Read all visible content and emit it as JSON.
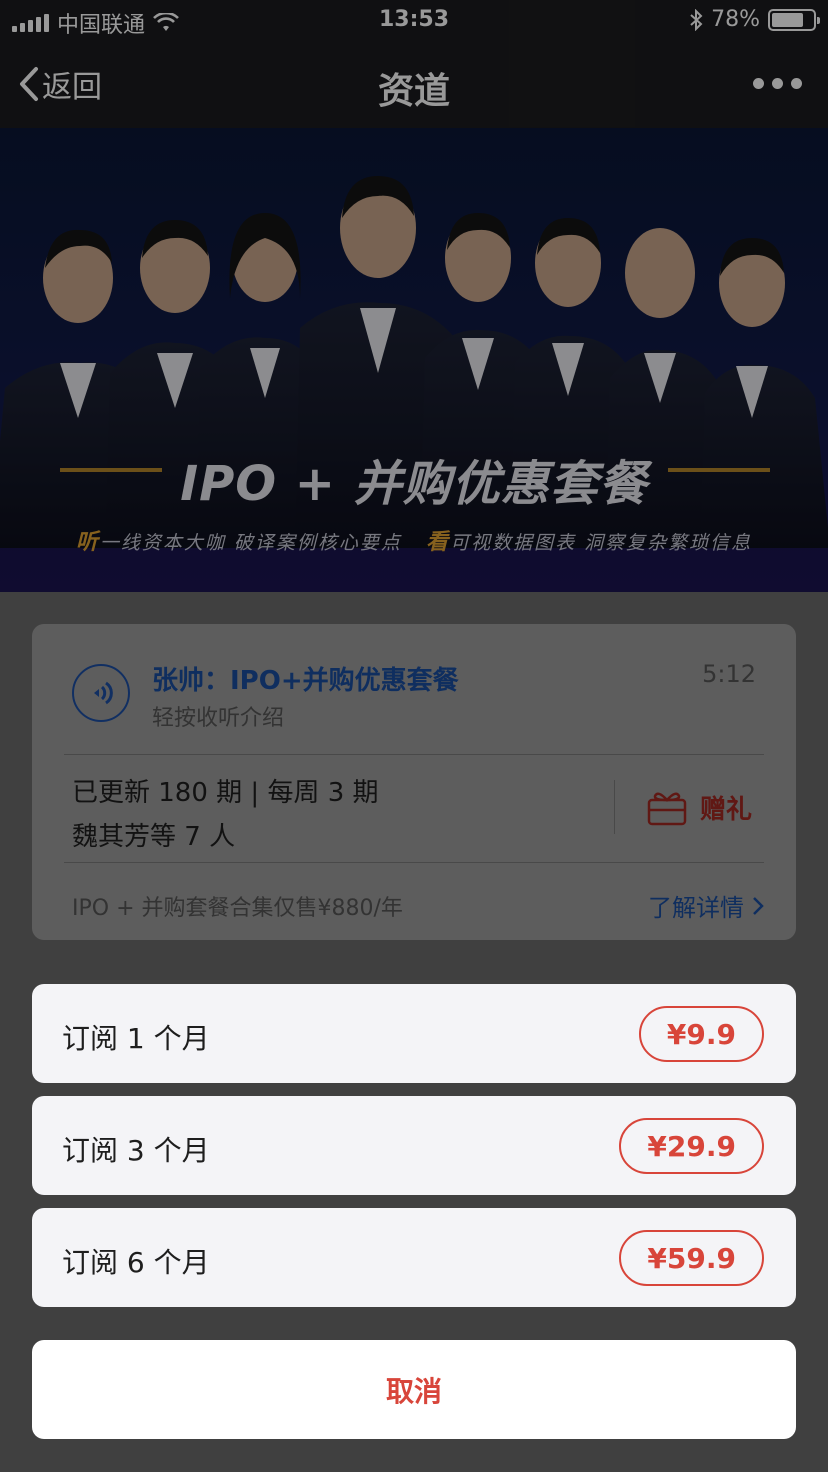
{
  "status_bar": {
    "carrier": "中国联通",
    "time": "13:53",
    "battery": "78%",
    "battery_level": 0.78
  },
  "nav": {
    "back_label": "返回",
    "title": "资道"
  },
  "banner": {
    "headline": "IPO + 并购优惠套餐",
    "listen_char": "听",
    "listen_text": "一线资本大咖 破译案例核心要点",
    "look_char": "看",
    "look_text": "可视数据图表 洞察复杂繁琐信息"
  },
  "card": {
    "title": "张帅：IPO+并购优惠套餐",
    "subtitle": "轻按收听介绍",
    "duration": "5:12",
    "updates": "已更新 180 期 | 每周 3 期",
    "people": "魏其芳等 7 人",
    "gift_label": "赠礼",
    "promo": "IPO + 并购套餐合集仅售¥880/年",
    "more_label": "了解详情"
  },
  "options": [
    {
      "label": "订阅 1 个月",
      "price": "¥9.9"
    },
    {
      "label": "订阅 3 个月",
      "price": "¥29.9"
    },
    {
      "label": "订阅 6 个月",
      "price": "¥59.9"
    }
  ],
  "cancel_label": "取消",
  "colors": {
    "accent_red": "#d8453a",
    "link_blue": "#1a4d9e",
    "banner_gold": "#b5862a"
  }
}
